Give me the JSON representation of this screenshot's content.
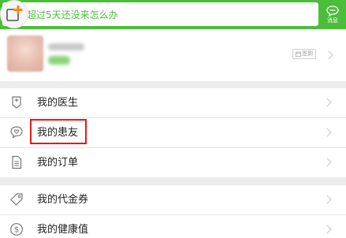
{
  "banner": {
    "text": "超过5天还没来怎么办",
    "chat_label": "消息",
    "add_icon": "add-plus-icon",
    "chat_icon": "chat-bubble-icon"
  },
  "profile": {
    "checkin_label": "签到",
    "checkin_icon": "calendar-icon"
  },
  "menu": [
    {
      "label": "我的医生",
      "icon": "doctor-badge-icon"
    },
    {
      "label": "我的患友",
      "icon": "heart-chat-icon"
    },
    {
      "label": "我的订单",
      "icon": "order-document-icon"
    },
    {
      "label": "我的代金券",
      "icon": "coupon-tag-icon"
    },
    {
      "label": "我的健康值",
      "icon": "dollar-circle-icon"
    }
  ],
  "colors": {
    "brand_green": "#4cbd3a",
    "highlight_red": "#e01c1c"
  }
}
